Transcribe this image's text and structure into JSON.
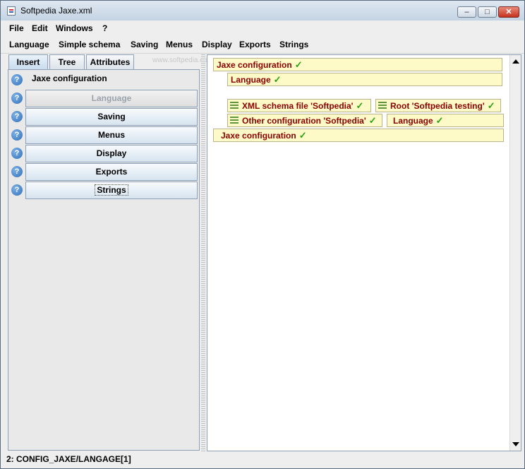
{
  "window": {
    "title": "Softpedia Jaxe.xml",
    "minimize": "–",
    "maximize": "□",
    "close": "✕"
  },
  "menubar": {
    "items": [
      "File",
      "Edit",
      "Windows",
      "?"
    ]
  },
  "elements_menu": {
    "items": [
      "Language",
      "Simple schema",
      "Saving",
      "Menus",
      "Display",
      "Exports",
      "Strings"
    ]
  },
  "watermark": "www.softpedia.com",
  "tabs": [
    "Insert",
    "Tree",
    "Attributes"
  ],
  "insert_panel": {
    "parent_label": "Jaxe configuration",
    "buttons": [
      "Language",
      "Saving",
      "Menus",
      "Display",
      "Exports",
      "Strings"
    ]
  },
  "editor": {
    "tag_jaxe_open": "Jaxe configuration",
    "tag_language_open": "Language",
    "tag_xml_schema": "XML schema file 'Softpedia'",
    "tag_root": "Root 'Softpedia testing'",
    "tag_other_config": "Other configuration 'Softpedia'",
    "tag_language_close": "Language",
    "tag_jaxe_close": "Jaxe configuration"
  },
  "status": {
    "path": "2: CONFIG_JAXE/LANGAGE[1]"
  },
  "colors": {
    "tag_bg": "#fdfac8",
    "tag_text": "#8b0000",
    "check": "#2ea012",
    "help_icon": "#2f6fb8"
  }
}
